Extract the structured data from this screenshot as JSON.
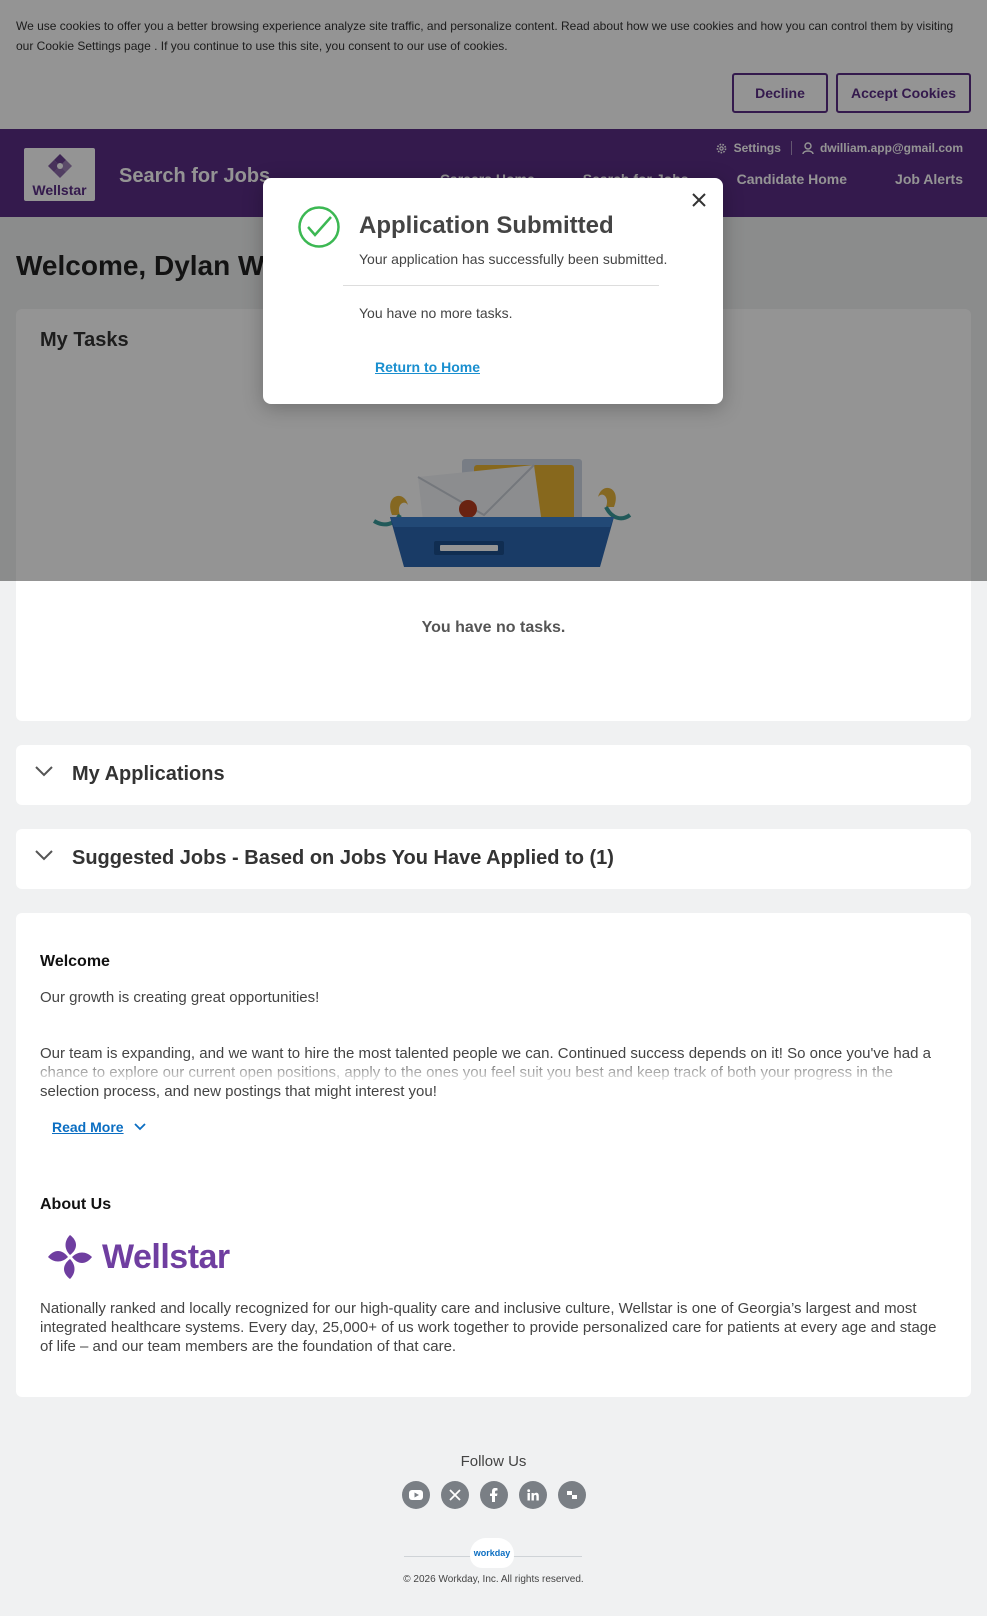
{
  "cookie": {
    "text": "We use cookies to offer you a better browsing experience analyze site traffic, and personalize content.   Read about how we use cookies and how you can control them by visiting our Cookie Settings page .  If you continue to use this site, you consent to our use of cookies.",
    "decline_label": "Decline",
    "accept_label": "Accept Cookies"
  },
  "header": {
    "logo_text": "Wellstar",
    "title": "Search for Jobs",
    "settings_label": "Settings",
    "user_email": "dwilliam.app@gmail.com",
    "nav": [
      "Careers Home",
      "Search for Jobs",
      "Candidate Home",
      "Job Alerts"
    ]
  },
  "main": {
    "welcome": "Welcome, Dylan Wil",
    "tasks_title": "My Tasks",
    "no_tasks": "You have no tasks.",
    "applications_title": "My Applications",
    "suggested_title": "Suggested Jobs - Based on Jobs You Have Applied to (1)"
  },
  "info": {
    "welcome_heading": "Welcome",
    "growth_text": "Our growth is creating great opportunities!",
    "team_text": "Our team is expanding, and we want to hire the most talented people we can. Continued success depends on it! So once you've had a chance to explore our current open positions, apply to the ones you feel suit you best and keep track of both your progress in the selection process, and new postings that might interest you!",
    "read_more": "Read More",
    "about_heading": "About Us",
    "logo_text": "Wellstar",
    "about_text": "Nationally ranked and locally recognized for our high-quality care and inclusive culture, Wellstar is one of Georgia’s largest and most integrated healthcare systems. Every day, 25,000+ of us work together to provide personalized care for patients at every age and stage of life – and our team members are the foundation of that care."
  },
  "footer": {
    "follow_label": "Follow Us",
    "social": [
      "youtube-icon",
      "x-icon",
      "facebook-icon",
      "linkedin-icon",
      "glassdoor-icon"
    ],
    "workday_badge": "workday",
    "copyright": "© 2026 Workday, Inc. All rights reserved."
  },
  "modal": {
    "title": "Application Submitted",
    "subtitle": "Your application has successfully been submitted.",
    "tasks_text": "You have no more tasks.",
    "link_label": "Return to Home"
  },
  "colors": {
    "brand_purple": "#5b2d86",
    "logo_purple": "#6f3ea0",
    "success_green": "#3cb853",
    "link_blue": "#1a8fcf"
  }
}
